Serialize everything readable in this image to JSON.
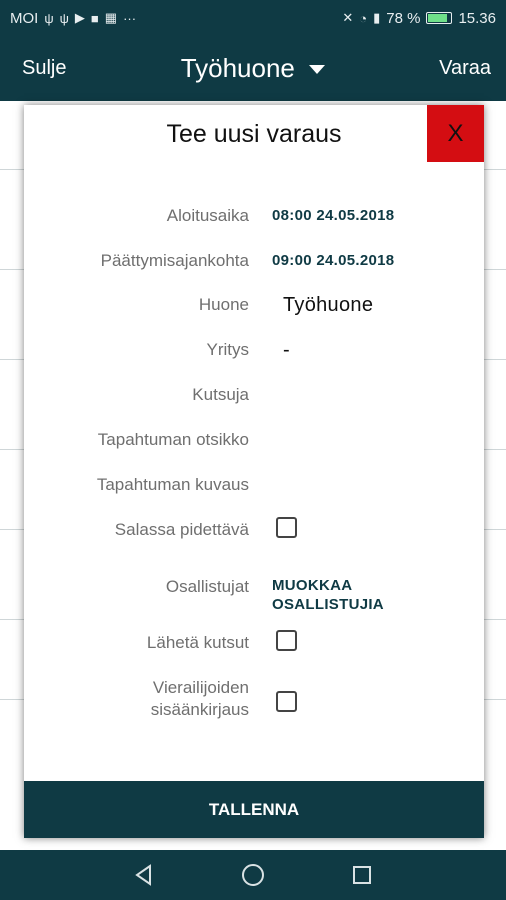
{
  "status_bar": {
    "carrier": "MOI",
    "battery_percent": "78 %",
    "time": "15.36"
  },
  "app_bar": {
    "close_label": "Sulje",
    "title": "Työhuone",
    "book_label": "Varaa"
  },
  "dialog": {
    "title": "Tee uusi varaus",
    "close_label": "X",
    "fields": {
      "start_label": "Aloitusaika",
      "start_value": "08:00 24.05.2018",
      "end_label": "Päättymisajankohta",
      "end_value": "09:00 24.05.2018",
      "room_label": "Huone",
      "room_value": "Työhuone",
      "company_label": "Yritys",
      "company_value": "-",
      "inviter_label": "Kutsuja",
      "event_title_label": "Tapahtuman otsikko",
      "event_desc_label": "Tapahtuman kuvaus",
      "confidential_label": "Salassa pidettävä",
      "participants_label": "Osallistujat",
      "participants_link_line1": "MUOKKAA",
      "participants_link_line2": "OSALLISTUJIA",
      "send_invites_label": "Lähetä kutsut",
      "visitor_checkin_line1": "Vierailijoiden",
      "visitor_checkin_line2": "sisäänkirjaus"
    },
    "save_label": "TALLENNA"
  },
  "colors": {
    "primary": "#0f3a44",
    "close_red": "#d40d12"
  }
}
